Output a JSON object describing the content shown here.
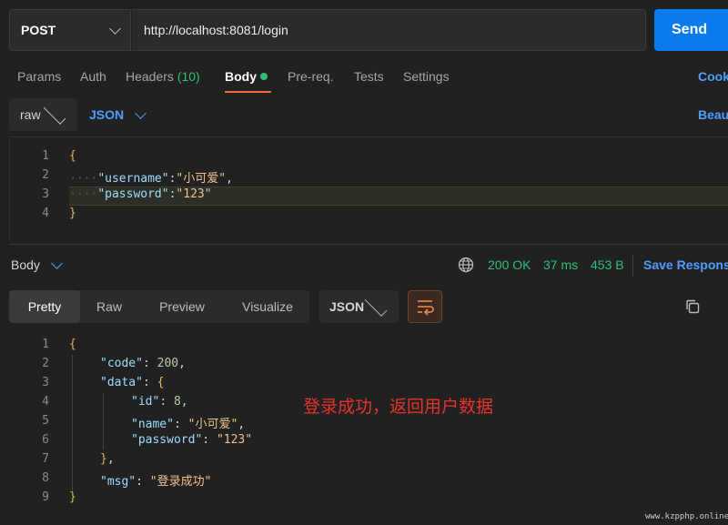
{
  "request": {
    "method": "POST",
    "url": "http://localhost:8081/login",
    "send_label": "Send"
  },
  "request_tabs": [
    {
      "label": "Params"
    },
    {
      "label": "Auth"
    },
    {
      "label": "Headers",
      "count": "(10)"
    },
    {
      "label": "Body"
    },
    {
      "label": "Pre-req."
    },
    {
      "label": "Tests"
    },
    {
      "label": "Settings"
    }
  ],
  "cookies_label": "Cook",
  "body_mode": {
    "type": "raw",
    "language": "JSON",
    "beautify_label": "Beau"
  },
  "request_body": {
    "line_numbers": [
      "1",
      "2",
      "3",
      "4"
    ],
    "open_brace": "{",
    "username_key": "\"username\"",
    "username_value": "\"小可爱\"",
    "password_key": "\"password\"",
    "password_value": "\"123\"",
    "close_brace": "}"
  },
  "response": {
    "body_label": "Body",
    "status": "200 OK",
    "time": "37 ms",
    "size": "453 B",
    "save_label": "Save Respons",
    "view_tabs": [
      "Pretty",
      "Raw",
      "Preview",
      "Visualize"
    ],
    "format": "JSON"
  },
  "response_body": {
    "line_numbers": [
      "1",
      "2",
      "3",
      "4",
      "5",
      "6",
      "7",
      "8",
      "9"
    ],
    "open_brace": "{",
    "code_key": "\"code\"",
    "code_value": "200",
    "data_key": "\"data\"",
    "data_open": "{",
    "id_key": "\"id\"",
    "id_value": "8",
    "name_key": "\"name\"",
    "name_value": "\"小可爱\"",
    "password_key": "\"password\"",
    "password_value": "\"123\"",
    "data_close": "}",
    "msg_key": "\"msg\"",
    "msg_value": "\"登录成功\"",
    "close_brace": "}"
  },
  "annotation": "登录成功，返回用户数据",
  "watermark": "www.kzpphp.online",
  "colors": {
    "accent": "#097bed",
    "active_tab_underline": "#f26b3a",
    "success": "#2ec07a",
    "annotation": "#e8322c"
  }
}
